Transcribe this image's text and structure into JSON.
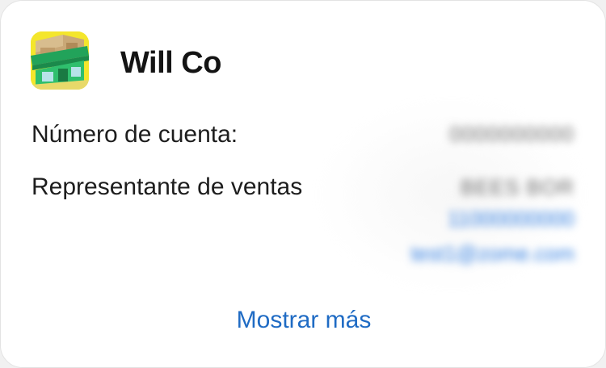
{
  "vendor": {
    "name": "Will Co",
    "logo_icon": "storefront-icon"
  },
  "details": {
    "account_label": "Número de cuenta:",
    "account_value": "0000000000",
    "sales_rep_label": "Representante de ventas",
    "sales_rep_name": "BEES BOR",
    "sales_rep_phone": "11000000000",
    "sales_rep_email": "test1@zome.com"
  },
  "actions": {
    "show_more_label": "Mostrar más"
  },
  "colors": {
    "link": "#1f6bc4",
    "logo_background": "#f5e82a",
    "awning": "#22a35a"
  }
}
